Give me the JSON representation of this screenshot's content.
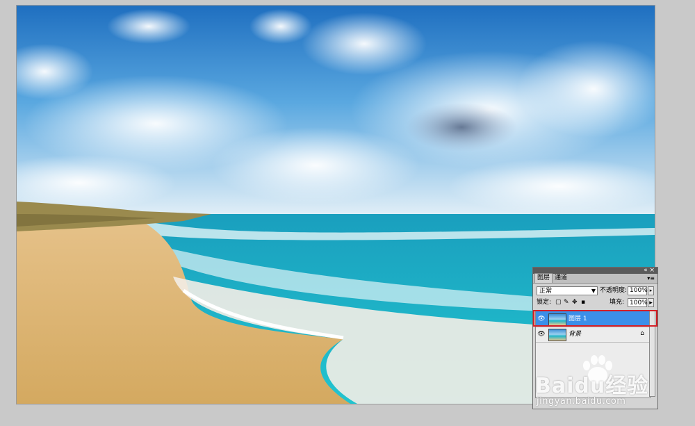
{
  "layers_panel": {
    "tabs": [
      "图层",
      "通道"
    ],
    "blend_mode": "正常",
    "opacity_label": "不透明度:",
    "opacity_value": "100%",
    "lock_label": "锁定:",
    "fill_label": "填充:",
    "fill_value": "100%",
    "layers": [
      {
        "name": "图层 1",
        "selected": true,
        "visible": true
      },
      {
        "name": "背景",
        "selected": false,
        "visible": true,
        "locked": true
      }
    ]
  },
  "watermark": {
    "brand": "Baidu经验",
    "url": "jingyan.baidu.com"
  },
  "colors": {
    "selection": "#3b8fe9",
    "highlight_border": "#d61f26"
  }
}
